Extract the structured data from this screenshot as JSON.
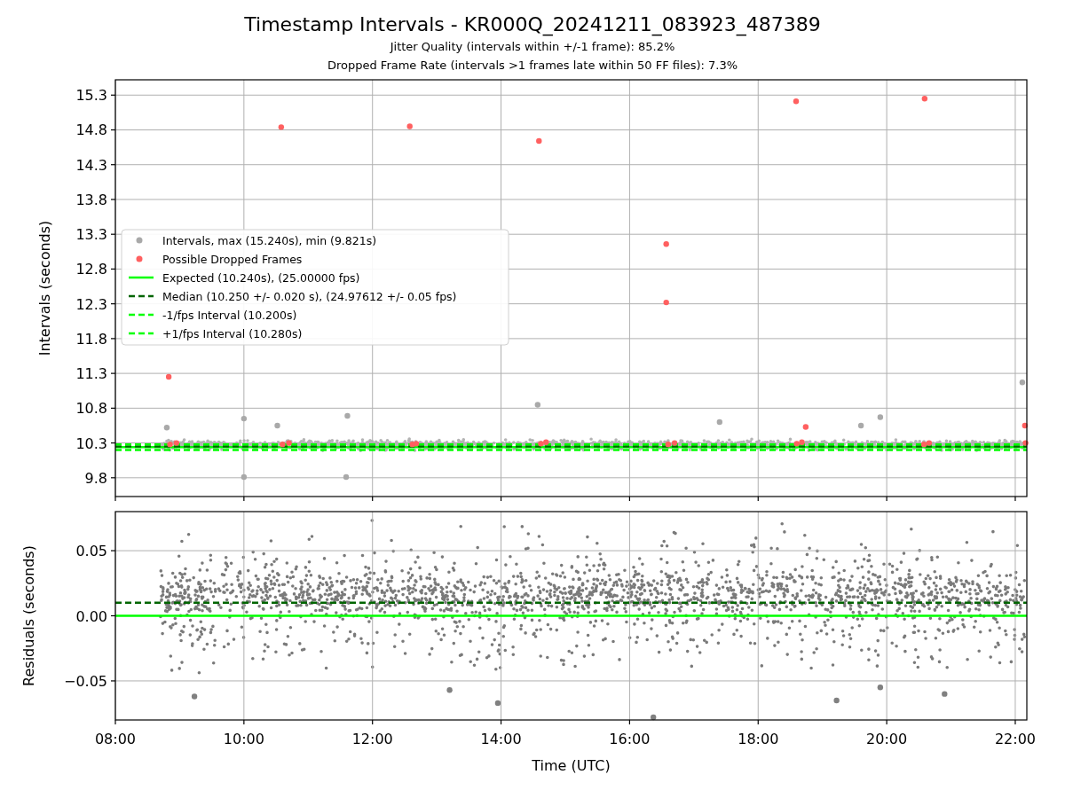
{
  "title": "Timestamp Intervals - KR000Q_20241211_083923_487389",
  "subtitles": [
    "Jitter Quality (intervals within +/-1 frame): 85.2%",
    "Dropped Frame Rate (intervals >1 frames late within 50 FF files): 7.3%"
  ],
  "top_chart": {
    "chart_data": {
      "type": "scatter",
      "ylabel": "Intervals (seconds)",
      "xlim": [
        8,
        22.18
      ],
      "ylim": [
        9.53,
        15.52
      ],
      "yticks": [
        {
          "value": 9.8,
          "label": "9.8"
        },
        {
          "value": 10.3,
          "label": "10.3"
        },
        {
          "value": 10.8,
          "label": "10.8"
        },
        {
          "value": 11.3,
          "label": "11.3"
        },
        {
          "value": 11.8,
          "label": "11.8"
        },
        {
          "value": 12.3,
          "label": "12.3"
        },
        {
          "value": 12.8,
          "label": "12.8"
        },
        {
          "value": 13.3,
          "label": "13.3"
        },
        {
          "value": 13.8,
          "label": "13.8"
        },
        {
          "value": 14.3,
          "label": "14.3"
        },
        {
          "value": 14.8,
          "label": "14.8"
        },
        {
          "value": 15.3,
          "label": "15.3"
        }
      ],
      "series": [
        {
          "name": "Intervals, max (15.240s), min (9.821s)",
          "color": "#a9a9a9",
          "x": [
            10.0,
            10.0,
            11.59,
            11.61,
            14.57,
            22.11,
            10.52,
            8.8,
            17.4,
            19.6,
            19.9
          ],
          "values": [
            10.65,
            9.81,
            9.81,
            10.69,
            10.85,
            11.17,
            10.55,
            10.52,
            10.6,
            10.55,
            10.67
          ]
        },
        {
          "name": "Possible Dropped Frames",
          "color": "#ff6060",
          "x": [
            8.83,
            10.58,
            12.58,
            14.59,
            16.57,
            16.57,
            18.59,
            20.59,
            22.15,
            18.74,
            8.85,
            8.95,
            10.6,
            10.7,
            12.62,
            12.68,
            14.62,
            14.7,
            16.6,
            16.7,
            18.6,
            18.68,
            20.58,
            20.66,
            22.16
          ],
          "values": [
            11.25,
            14.84,
            14.85,
            14.64,
            13.16,
            12.32,
            15.21,
            15.25,
            10.55,
            10.53,
            10.28,
            10.3,
            10.28,
            10.3,
            10.28,
            10.29,
            10.29,
            10.31,
            10.28,
            10.3,
            10.29,
            10.31,
            10.28,
            10.3,
            10.3
          ]
        },
        {
          "name": "Expected (10.240s), (25.00000 fps)",
          "type": "line",
          "line_style": "solid",
          "color": "#00ff00",
          "x": [
            8,
            22.18
          ],
          "values": [
            10.24,
            10.24
          ]
        },
        {
          "name": "Median (10.250 +/- 0.020 s), (24.97612 +/- 0.05 fps)",
          "type": "line",
          "line_style": "dashed",
          "color": "#006400",
          "x": [
            8,
            22.18
          ],
          "values": [
            10.25,
            10.25
          ]
        },
        {
          "name": "-1/fps Interval (10.200s)",
          "type": "line",
          "line_style": "dashed",
          "color": "#00ff00",
          "x": [
            8,
            22.18
          ],
          "values": [
            10.2,
            10.2
          ]
        },
        {
          "name": "+1/fps Interval (10.280s)",
          "type": "line",
          "line_style": "dashed",
          "color": "#00ff00",
          "x": [
            8,
            22.18
          ],
          "values": [
            10.28,
            10.28
          ]
        }
      ],
      "grid": true,
      "legend": true
    }
  },
  "bottom_chart": {
    "chart_data": {
      "type": "scatter",
      "xlabel": "Time (UTC)",
      "ylabel": "Residuals (seconds)",
      "xlim": [
        8,
        22.18
      ],
      "ylim": [
        -0.08,
        0.08
      ],
      "xticks": [
        {
          "value": 8,
          "label": "08:00"
        },
        {
          "value": 10,
          "label": "10:00"
        },
        {
          "value": 12,
          "label": "12:00"
        },
        {
          "value": 14,
          "label": "14:00"
        },
        {
          "value": 16,
          "label": "16:00"
        },
        {
          "value": 18,
          "label": "18:00"
        },
        {
          "value": 20,
          "label": "20:00"
        },
        {
          "value": 22,
          "label": "22:00"
        }
      ],
      "yticks": [
        {
          "value": 0.05,
          "label": "0.05"
        },
        {
          "value": 0,
          "label": "0.00"
        },
        {
          "value": -0.05,
          "label": "−0.05"
        }
      ],
      "series": [
        {
          "color": "#808080",
          "x": [
            9.23,
            13.2,
            13.95,
            16.37,
            19.22,
            19.9,
            20.9
          ],
          "values": [
            -0.062,
            -0.057,
            -0.067,
            -0.078,
            -0.065,
            -0.055,
            -0.06
          ]
        },
        {
          "type": "line",
          "line_style": "solid",
          "color": "#00ff00",
          "x": [
            8,
            22.18
          ],
          "values": [
            0,
            0
          ]
        },
        {
          "type": "line",
          "line_style": "dashed",
          "color": "#006400",
          "x": [
            8,
            22.18
          ],
          "values": [
            0.01,
            0.01
          ]
        }
      ],
      "grid": true
    }
  }
}
